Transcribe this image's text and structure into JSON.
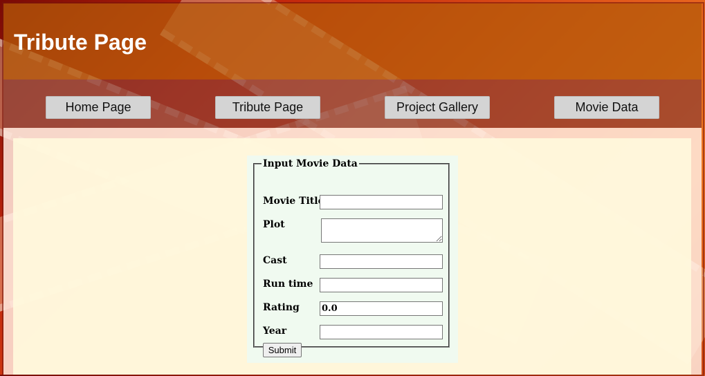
{
  "header": {
    "title": "Tribute Page"
  },
  "nav": {
    "items": [
      {
        "label": "Home Page"
      },
      {
        "label": "Tribute Page"
      },
      {
        "label": "Project Gallery"
      },
      {
        "label": "Movie Data"
      }
    ]
  },
  "form": {
    "legend": "Input Movie Data",
    "fields": {
      "title_label": "Movie Title",
      "title_value": "",
      "plot_label": "Plot",
      "plot_value": "",
      "cast_label": "Cast",
      "cast_value": "",
      "runtime_label": "Run time",
      "runtime_value": "",
      "rating_label": "Rating",
      "rating_value": "0.0",
      "year_label": "Year",
      "year_value": ""
    },
    "submit_label": "Submit"
  }
}
